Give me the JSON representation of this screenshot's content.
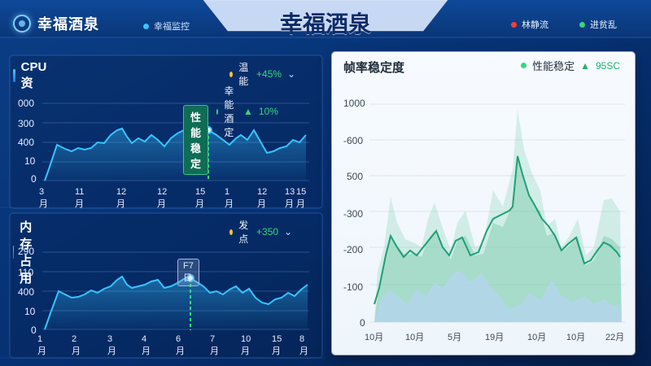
{
  "header": {
    "brand_name": "幸福酒泉",
    "monitor_label": "幸福监控",
    "center_title": "幸福酒泉",
    "status_items": [
      {
        "label": "林静流",
        "color": "#ff3b3b"
      },
      {
        "label": "进贫乱",
        "color": "#38d67b"
      }
    ]
  },
  "cpu_panel": {
    "title": "CPU 资",
    "legend1": {
      "label": "温能",
      "value": "+45%"
    },
    "legend2": {
      "label": "幸能酒定",
      "value": "10%"
    },
    "tooltip": "性能稳定",
    "y_labels": [
      "000",
      "300",
      "400",
      "10",
      "0"
    ],
    "x_labels": [
      "3月",
      "11月",
      "12月",
      "12月",
      "15月",
      "1月",
      "12月",
      "13月",
      "15月"
    ]
  },
  "mem_panel": {
    "title": "内存占用",
    "legend": {
      "label": "发点",
      "value": "+350"
    },
    "tooltip": "F7日",
    "y_labels": [
      "290",
      "110",
      "400",
      "10",
      "0"
    ],
    "x_labels": [
      "1月",
      "2月",
      "3月",
      "4月",
      "6月",
      "7月",
      "10月",
      "15月",
      "8月"
    ]
  },
  "right_panel": {
    "title": "帧率稳定度",
    "legend": {
      "label": "性能稳定",
      "value": "95SC"
    },
    "y_labels": [
      "1000",
      "-600",
      "500",
      "-300",
      "-200",
      "-100",
      "0"
    ],
    "x_labels": [
      "10月",
      "10月",
      "5月",
      "19月",
      "10月",
      "10月",
      "22月"
    ]
  },
  "colors": {
    "accent_green": "#38d67b",
    "accent_yellow": "#f4c430",
    "line_cyan": "#39c4ff",
    "right_green": "#21a977"
  }
}
